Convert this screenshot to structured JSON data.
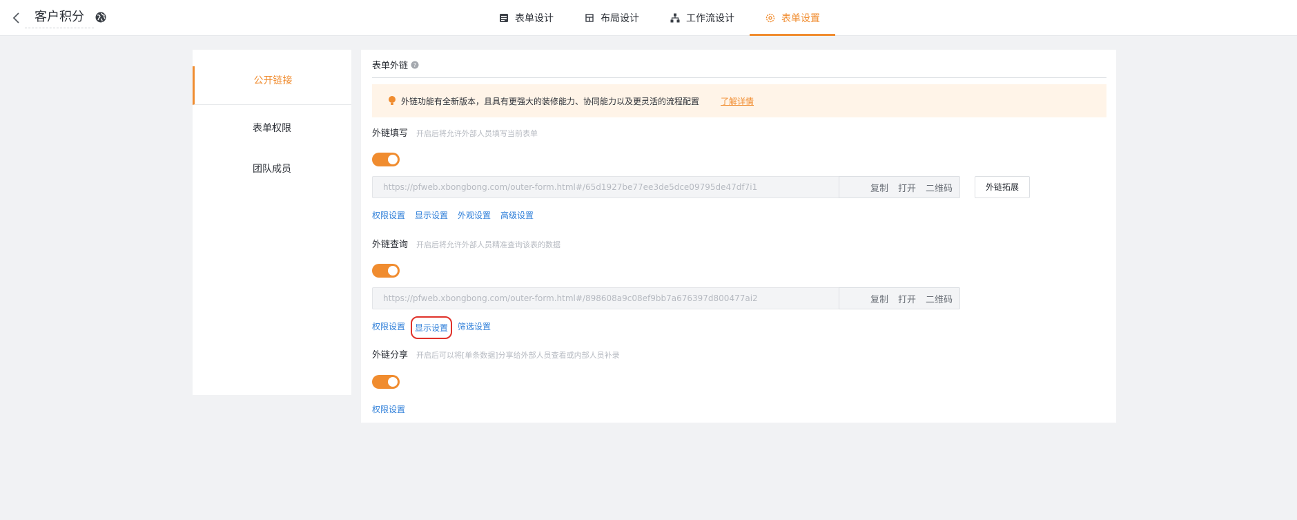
{
  "header": {
    "title": "客户积分",
    "tabs": [
      {
        "label": "表单设计",
        "icon": "form-icon"
      },
      {
        "label": "布局设计",
        "icon": "layout-icon"
      },
      {
        "label": "工作流设计",
        "icon": "workflow-icon"
      },
      {
        "label": "表单设置",
        "icon": "settings-icon",
        "active": true
      }
    ]
  },
  "sidebar": {
    "items": [
      {
        "label": "公开链接",
        "active": true
      },
      {
        "label": "表单权限"
      },
      {
        "label": "团队成员"
      }
    ]
  },
  "main": {
    "section_title": "表单外链",
    "notice": {
      "text": "外链功能有全新版本，且具有更强大的装修能力、协同能力以及更灵活的流程配置",
      "link": "了解详情"
    },
    "fill": {
      "label": "外链填写",
      "hint": "开启后将允许外部人员填写当前表单",
      "enabled": true,
      "url": "https://pfweb.xbongbong.com/outer-form.html#/65d1927be77ee3de5dce09795de47df7i1",
      "actions": [
        "复制",
        "打开",
        "二维码"
      ],
      "extend_button": "外链拓展",
      "links": [
        "权限设置",
        "显示设置",
        "外观设置",
        "高级设置"
      ]
    },
    "query": {
      "label": "外链查询",
      "hint": "开启后将允许外部人员精准查询该表的数据",
      "enabled": true,
      "url": "https://pfweb.xbongbong.com/outer-form.html#/898608a9c08ef9bb7a676397d800477ai2",
      "actions": [
        "复制",
        "打开",
        "二维码"
      ],
      "links": [
        "权限设置",
        "显示设置",
        "筛选设置"
      ]
    },
    "share": {
      "label": "外链分享",
      "hint": "开启后可以将[单条数据]分享给外部人员查看或内部人员补录",
      "enabled": true,
      "links": [
        "权限设置"
      ]
    }
  },
  "colors": {
    "accent": "#f08c2f",
    "link": "#2f7fd9",
    "highlight": "#e0322a"
  }
}
